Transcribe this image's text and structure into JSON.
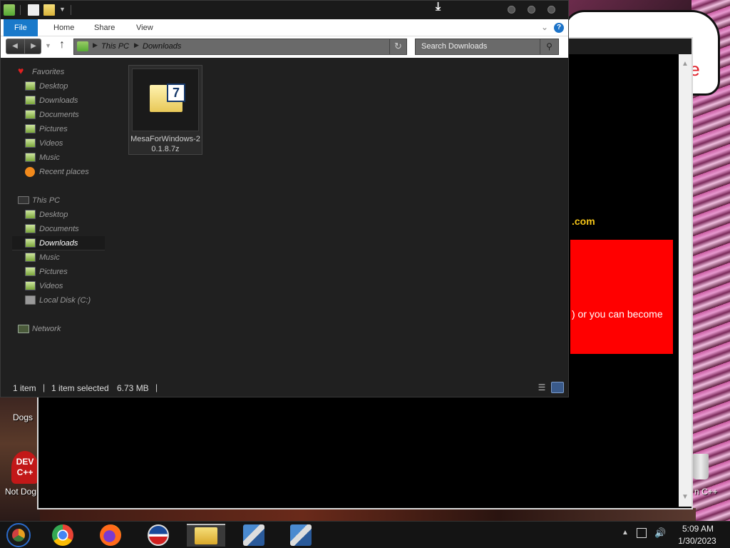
{
  "desktop": {
    "bg_speech_text": "te",
    "bg_domain_text": ".com",
    "bg_red_text": ") or you can become",
    "icon_labels": {
      "dogs": "Dogs",
      "not_dog": "Not Dog",
      "dev_cpp": "n C++"
    },
    "dev_icon_text": "DEV\nC++"
  },
  "explorer": {
    "ribbon": {
      "tabs": [
        "File",
        "Home",
        "Share",
        "View"
      ],
      "help": "?"
    },
    "address": {
      "segments": [
        "This PC",
        "Downloads"
      ]
    },
    "search": {
      "placeholder": "Search Downloads"
    },
    "nav": {
      "favorites": {
        "label": "Favorites",
        "items": [
          "Desktop",
          "Downloads",
          "Documents",
          "Pictures",
          "Videos",
          "Music",
          "Recent places"
        ]
      },
      "this_pc": {
        "label": "This PC",
        "items": [
          "Desktop",
          "Documents",
          "Downloads",
          "Music",
          "Pictures",
          "Videos",
          "Local Disk (C:)"
        ],
        "selected": "Downloads"
      },
      "network": {
        "label": "Network"
      }
    },
    "files": [
      {
        "name": "MesaForWindows-20.1.8.7z",
        "icon": "7zip-archive-icon"
      }
    ],
    "status": {
      "count": "1 item",
      "selection": "1 item selected",
      "size": "6.73 MB"
    }
  },
  "taskbar": {
    "apps": [
      "chrome-canary",
      "chrome",
      "firefox",
      "obama-logo",
      "file-explorer",
      "installer-1",
      "installer-2"
    ],
    "clock": {
      "time": "5:09 AM",
      "date": "1/30/2023"
    }
  },
  "colors": {
    "accent": "#1979ca",
    "explorer_bg": "#202020",
    "taskbar_bg": "#141414",
    "red_banner": "#ff0000",
    "domain_yellow": "#f5c518"
  }
}
